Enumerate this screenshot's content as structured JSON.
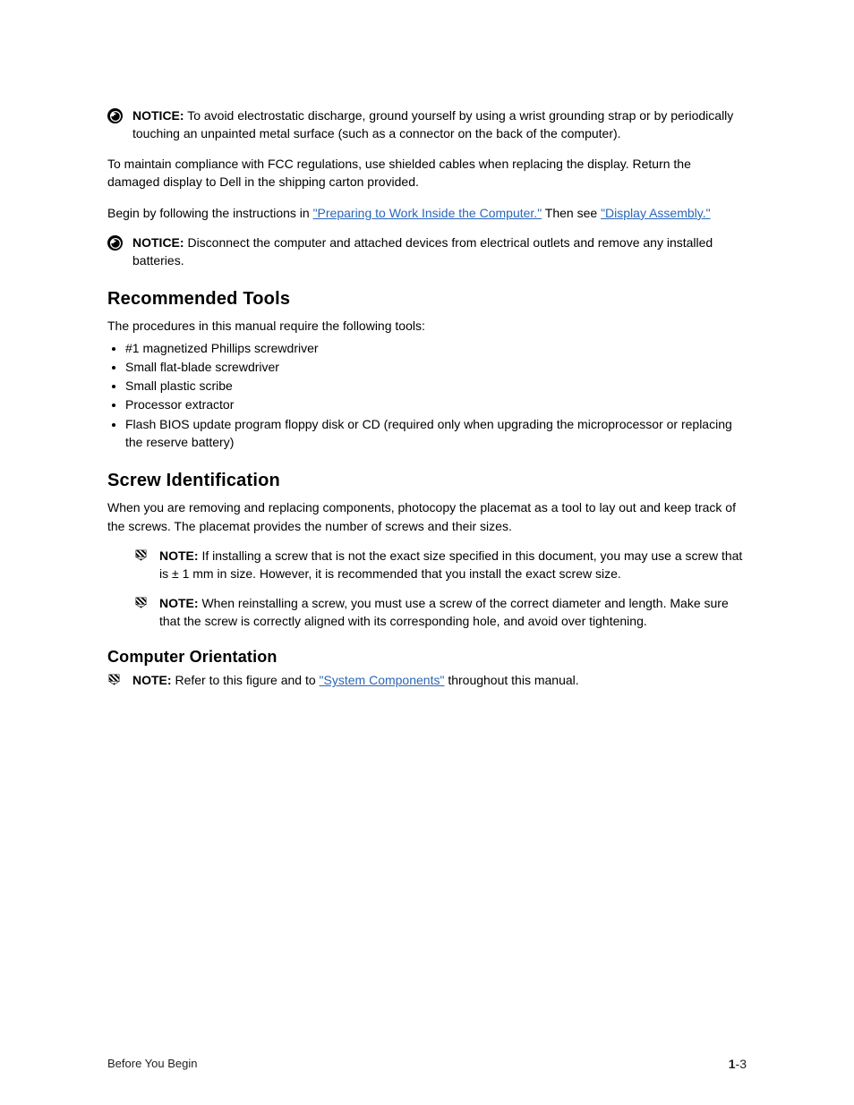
{
  "notice1": {
    "label": "NOTICE:",
    "text": " To avoid electrostatic discharge, ground yourself by using a wrist grounding strap or by periodically touching an unpainted metal surface (such as a connector on the back of the computer)."
  },
  "paragraph_fcc": "To maintain compliance with FCC regulations, use shielded cables when replacing the display. Return the damaged display to Dell in the shipping carton provided.",
  "paragraph_begin": {
    "pre": "Begin by following the instructions in ",
    "link": "\"Preparing to Work Inside the Computer.\"",
    "mid": " Then see ",
    "link2": "\"Display Assembly.\""
  },
  "notice2": {
    "label": "NOTICE:",
    "text": " Disconnect the computer and attached devices from electrical outlets and remove any installed batteries."
  },
  "section1": "Recommended Tools",
  "tools_intro": "The procedures in this manual require the following tools:",
  "tools": [
    "#1 magnetized Phillips screwdriver",
    "Small flat-blade screwdriver",
    "Small plastic scribe",
    "Processor extractor",
    "Flash BIOS update program floppy disk or CD (required only when upgrading the microprocessor or replacing the reserve battery)"
  ],
  "section2": "Screw Identification",
  "screw_p1_pre": "When you are removing and replacing components, photocopy the placemat as a tool to lay out and keep track of the screws. The placemat provides the number of screws and their sizes.",
  "note1": {
    "label": "NOTE:",
    "text": " If installing a screw that is not the exact size specified in this document, you may use a screw that is ± 1 mm in size. However, it is recommended that you install the exact screw size."
  },
  "note2": {
    "label": "NOTE:",
    "text": " When reinstalling a screw, you must use a screw of the correct diameter and length. Make sure that the screw is correctly aligned with its corresponding hole, and avoid over tightening."
  },
  "section3": "Computer Orientation",
  "note3": {
    "label": "NOTE:",
    "text_pre": " Refer to this figure and to ",
    "link": "\"System Components\"",
    "text_post": " throughout this manual."
  },
  "footer": {
    "left": "Before You Begin",
    "right_bold": "1",
    "right_rest": "-3"
  }
}
